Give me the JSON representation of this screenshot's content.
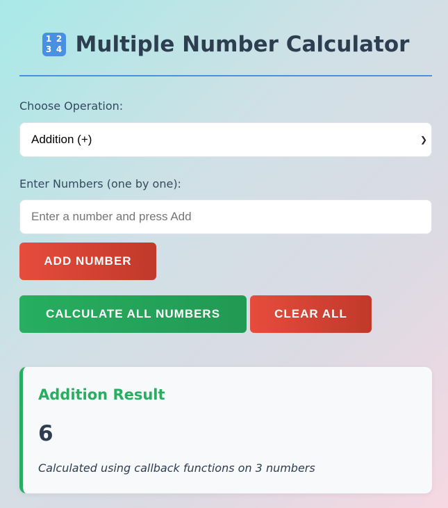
{
  "header": {
    "icon_top": "1 2",
    "icon_bottom": "3 4",
    "title": "Multiple Number Calculator"
  },
  "operation": {
    "label": "Choose Operation:",
    "selected": "Addition (+)"
  },
  "numbers": {
    "label": "Enter Numbers (one by one):",
    "placeholder": "Enter a number and press Add",
    "add_button": "ADD NUMBER"
  },
  "actions": {
    "calculate_button": "CALCULATE ALL NUMBERS",
    "clear_button": "CLEAR ALL"
  },
  "result": {
    "title": "Addition Result",
    "value": "6",
    "note": "Calculated using callback functions on 3 numbers"
  },
  "colors": {
    "accent": "#4a90e2",
    "danger": "#e74c3c",
    "success": "#27ae60",
    "text": "#2c3e50"
  }
}
